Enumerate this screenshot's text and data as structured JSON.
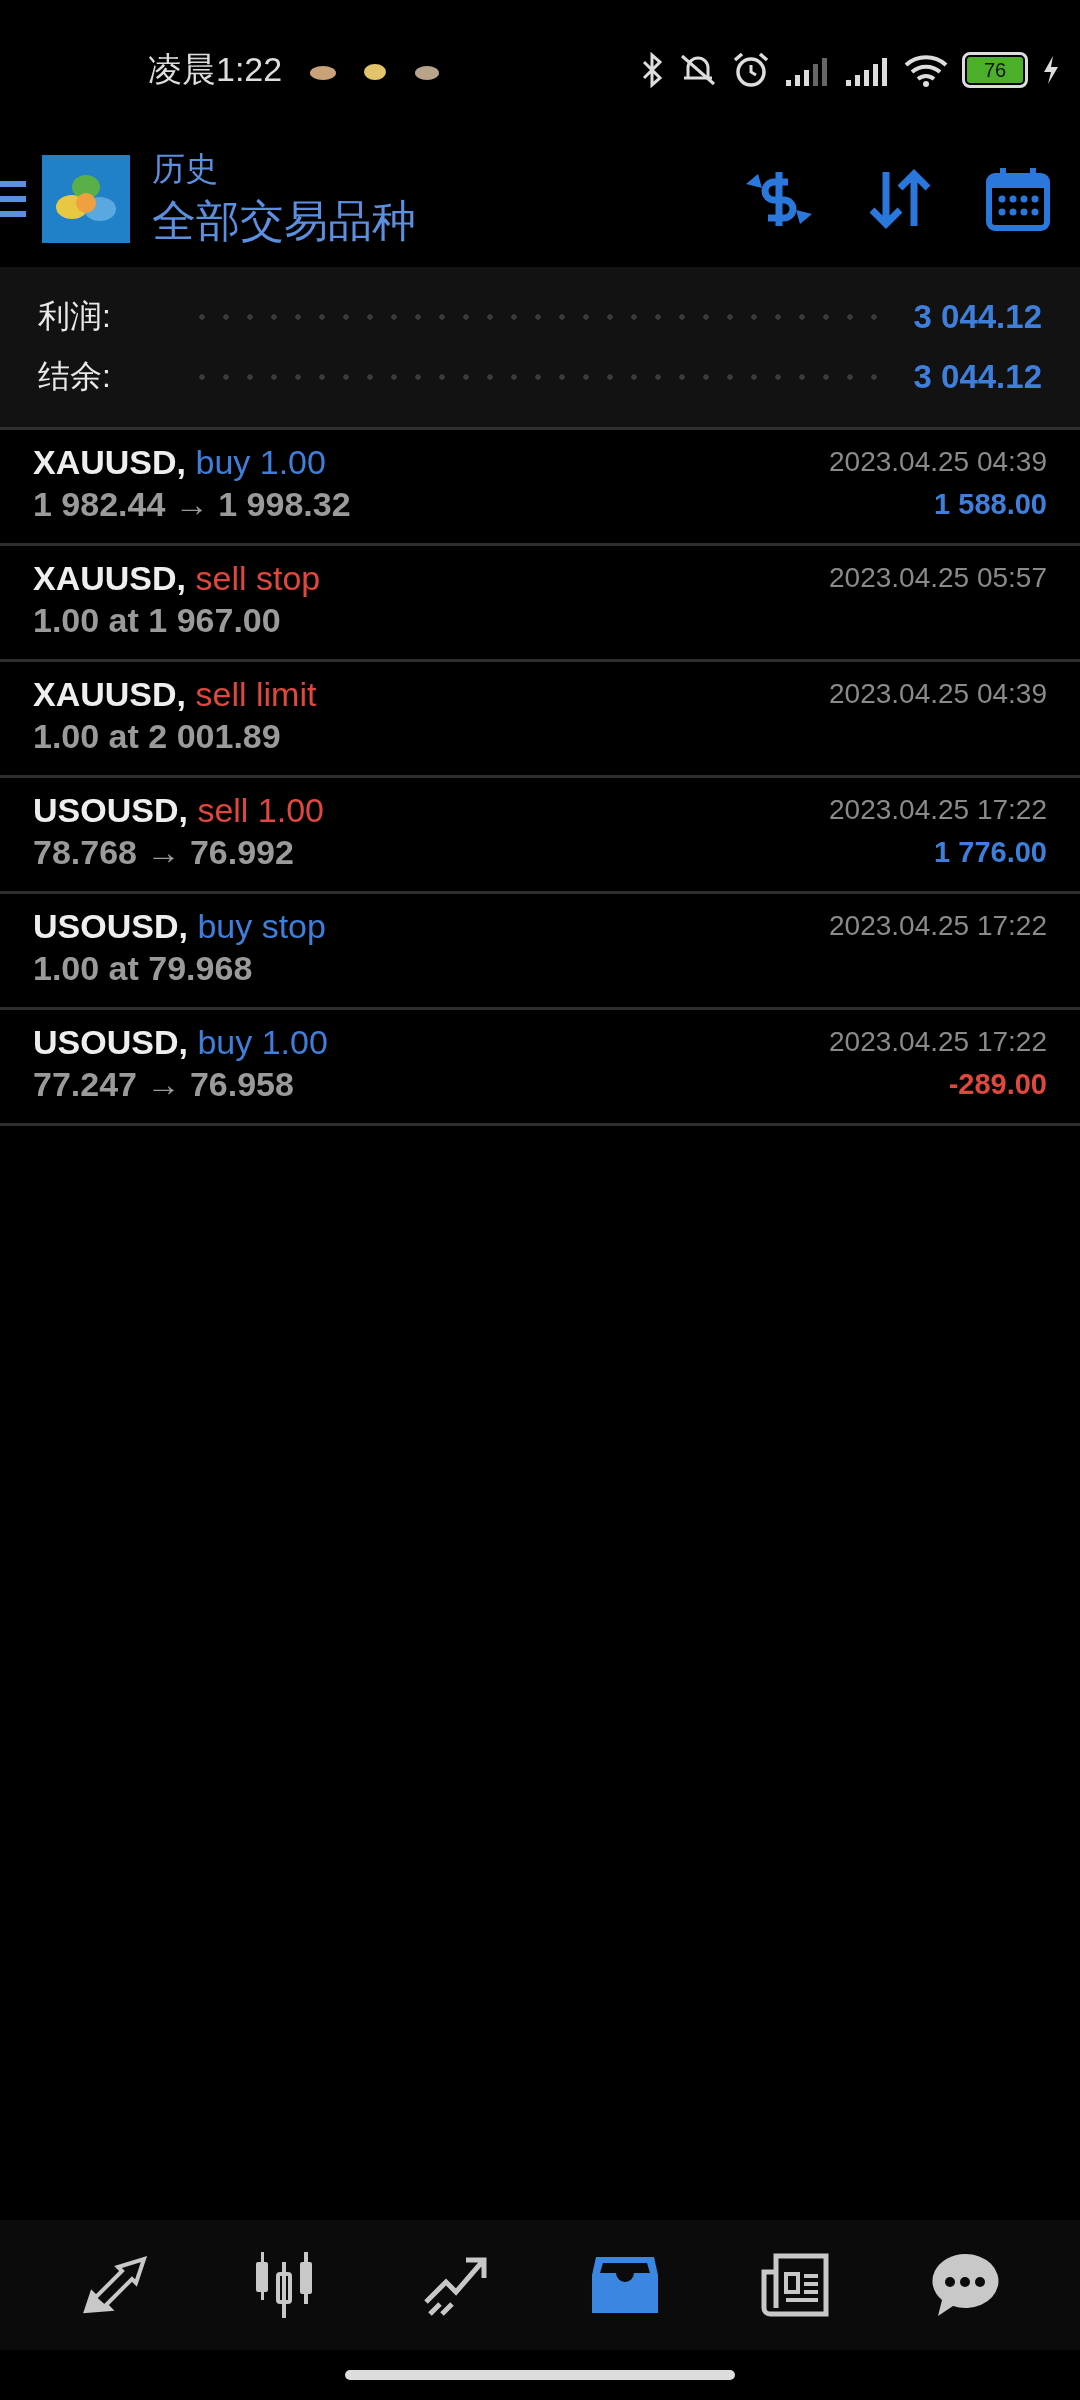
{
  "status_bar": {
    "time": "凌晨1:22",
    "battery": "76"
  },
  "header": {
    "title": "历史",
    "subtitle": "全部交易品种"
  },
  "summary": [
    {
      "label": "利润:",
      "value": "3 044.12"
    },
    {
      "label": "结余:",
      "value": "3 044.12"
    }
  ],
  "deals": [
    {
      "symbol": "XAUUSD,",
      "kind": "buy",
      "order": "buy 1.00",
      "detail": "1 982.44 → 1 998.32",
      "time": "2023.04.25 04:39",
      "profit": {
        "text": "1 588.00",
        "color": "#3f7fdc"
      }
    },
    {
      "symbol": "XAUUSD,",
      "kind": "sell",
      "order": "sell stop",
      "detail": "1.00 at 1 967.00",
      "time": "2023.04.25 05:57"
    },
    {
      "symbol": "XAUUSD,",
      "kind": "sell",
      "order": "sell limit",
      "detail": "1.00 at 2 001.89",
      "time": "2023.04.25 04:39"
    },
    {
      "symbol": "USOUSD,",
      "kind": "sell",
      "order": "sell 1.00",
      "detail": "78.768 → 76.992",
      "time": "2023.04.25 17:22",
      "profit": {
        "text": "1 776.00",
        "color": "#3f7fdc"
      }
    },
    {
      "symbol": "USOUSD,",
      "kind": "buy",
      "order": "buy stop",
      "detail": "1.00 at 79.968",
      "time": "2023.04.25 17:22"
    },
    {
      "symbol": "USOUSD,",
      "kind": "buy",
      "order": "buy 1.00",
      "detail": "77.247 → 76.958",
      "time": "2023.04.25 17:22",
      "profit": {
        "text": "-289.00",
        "color": "#e0483e"
      }
    }
  ],
  "nav": [
    {
      "kind": "quotes",
      "selected": false
    },
    {
      "kind": "chart",
      "selected": false
    },
    {
      "kind": "trade",
      "selected": false
    },
    {
      "kind": "history",
      "selected": true
    },
    {
      "kind": "news",
      "selected": false
    },
    {
      "kind": "chat",
      "selected": false
    }
  ]
}
